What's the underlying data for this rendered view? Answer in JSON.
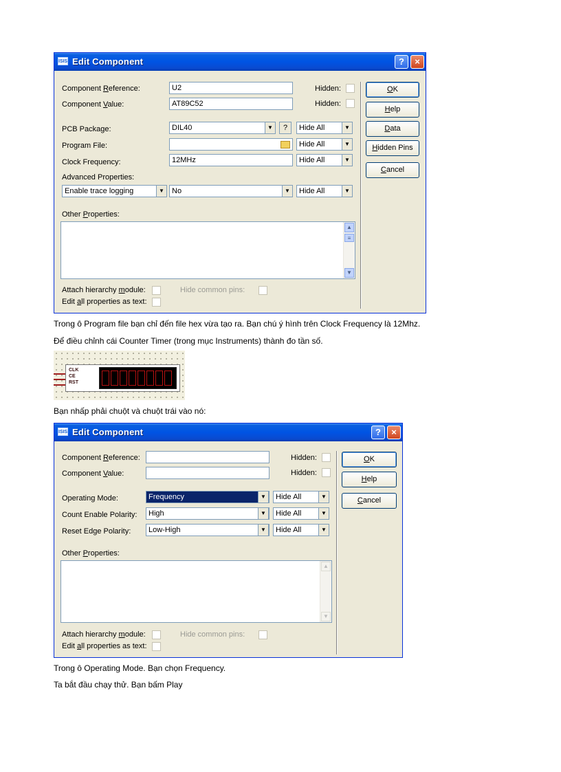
{
  "dialog1": {
    "title": "Edit Component",
    "help_btn": "?",
    "close_btn": "×",
    "component_reference": {
      "label_pre": "Component ",
      "label_u": "R",
      "label_post": "eference:",
      "value": "U2"
    },
    "component_value": {
      "label_pre": "Component ",
      "label_u": "V",
      "label_post": "alue:",
      "value": "AT89C52"
    },
    "hidden_label": "Hidden:",
    "pcb_package": {
      "label": "PCB Package:",
      "value": "DIL40",
      "q": "?",
      "vis": "Hide All"
    },
    "program_file": {
      "label": "Program File:",
      "value": "",
      "vis": "Hide All"
    },
    "clock_frequency": {
      "label": "Clock Frequency:",
      "value": "12MHz",
      "vis": "Hide All"
    },
    "advanced_label": "Advanced Properties:",
    "advanced": {
      "property": "Enable trace logging",
      "value": "No",
      "vis": "Hide All"
    },
    "other_props": {
      "pre": "Other ",
      "u": "P",
      "post": "roperties:"
    },
    "attach_module": {
      "pre": "Attach hierarchy ",
      "u": "m",
      "post": "odule:"
    },
    "hide_common_pins": "Hide common pins:",
    "edit_all": {
      "pre": "Edit ",
      "u": "a",
      "post": "ll properties as text:"
    },
    "buttons": {
      "ok": {
        "pre": "",
        "u": "O",
        "post": "K"
      },
      "help": {
        "pre": "",
        "u": "H",
        "post": "elp"
      },
      "data": {
        "pre": "",
        "u": "D",
        "post": "ata"
      },
      "hidden_pins": {
        "pre": "",
        "u": "H",
        "post": "idden Pins"
      },
      "cancel": {
        "pre": "",
        "u": "C",
        "post": "ancel"
      }
    }
  },
  "text1": "Trong ô Program file bạn chỉ đến file hex vừa tạo ra. Bạn chú ý hình trên Clock Frequency là 12Mhz.",
  "text2": "Để điều chỉnh cái Counter Timer (trong mục Instruments) thành đo tần số.",
  "counter": {
    "pins": [
      "CLK",
      "CE",
      "RST"
    ],
    "digit_count": 8,
    "color": "#b81111"
  },
  "text3": "Bạn nhấp phải chuột và chuột trái vào nó:",
  "dialog2": {
    "title": "Edit Component",
    "help_btn": "?",
    "close_btn": "×",
    "component_reference": {
      "label_pre": "Component ",
      "label_u": "R",
      "label_post": "eference:",
      "value": ""
    },
    "component_value": {
      "label_pre": "Component ",
      "label_u": "V",
      "label_post": "alue:",
      "value": ""
    },
    "hidden_label": "Hidden:",
    "operating_mode": {
      "label": "Operating Mode:",
      "value": "Frequency",
      "vis": "Hide All"
    },
    "count_enable": {
      "label": "Count Enable Polarity:",
      "value": "High",
      "vis": "Hide All"
    },
    "reset_edge": {
      "label": "Reset Edge Polarity:",
      "value": "Low-High",
      "vis": "Hide All"
    },
    "other_props": {
      "pre": "Other ",
      "u": "P",
      "post": "roperties:"
    },
    "attach_module": {
      "pre": "Attach hierarchy ",
      "u": "m",
      "post": "odule:"
    },
    "hide_common_pins": "Hide common pins:",
    "edit_all": {
      "pre": "Edit ",
      "u": "a",
      "post": "ll properties as text:"
    },
    "buttons": {
      "ok": {
        "pre": "",
        "u": "O",
        "post": "K"
      },
      "help": {
        "pre": "",
        "u": "H",
        "post": "elp"
      },
      "cancel": {
        "pre": "",
        "u": "C",
        "post": "ancel"
      }
    }
  },
  "text4": "Trong ô Operating Mode. Bạn chọn Frequency.",
  "text5": "Ta bắt đầu chạy thử. Bạn bấm Play",
  "colors": {
    "titlebar": "#0054e3",
    "dialog_bg": "#ece9d8",
    "selection": "#0a246a",
    "display_segment": "#b81111"
  }
}
